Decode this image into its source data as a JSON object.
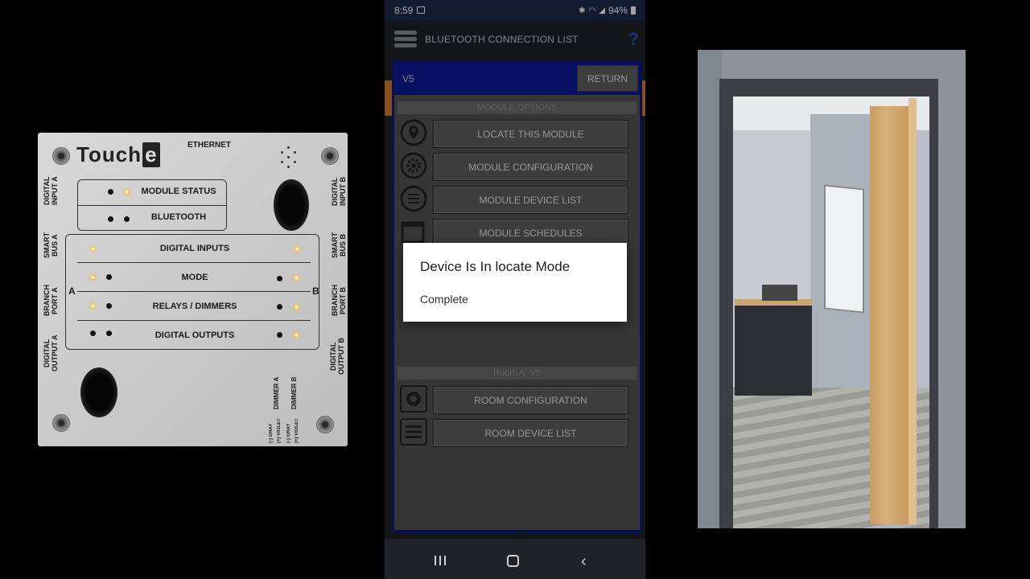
{
  "device": {
    "brand": "Touch",
    "brand_e": "e",
    "ethernet": "ETHERNET",
    "digital_input_a": "DIGITAL INPUT A",
    "digital_input_b": "DIGITAL INPUT B",
    "smart_bus_a": "SMART BUS A",
    "smart_bus_b": "SMART BUS B",
    "branch_port_a": "BRANCH PORT A",
    "branch_port_b": "BRANCH PORT B",
    "digital_output_a": "DIGITAL OUTPUT A",
    "digital_output_b": "DIGITAL OUTPUT B",
    "module_status": "MODULE STATUS",
    "bluetooth": "BLUETOOTH",
    "digital_inputs": "DIGITAL INPUTS",
    "mode": "MODE",
    "relays_dimmers": "RELAYS / DIMMERS",
    "digital_outputs": "DIGITAL OUTPUTS",
    "port_a": "A",
    "port_b": "B",
    "dimmer_a": "DIMMER A",
    "dimmer_b": "DIMMER B",
    "wire_gray": "(-) GRAY",
    "wire_violet": "(+) VIOLET"
  },
  "phone": {
    "status": {
      "time": "8:59",
      "battery": "94%"
    },
    "appbar": {
      "title": "BLUETOOTH CONNECTION LIST",
      "help": "?"
    },
    "card": {
      "name": "V5",
      "return_label": "RETURN",
      "module_options_header": "MODULE OPTIONS",
      "module_buttons": [
        {
          "label": "LOCATE THIS MODULE",
          "icon": "location-pin-icon"
        },
        {
          "label": "MODULE CONFIGURATION",
          "icon": "gear-icon"
        },
        {
          "label": "MODULE DEVICE LIST",
          "icon": "list-icon"
        },
        {
          "label": "MODULE SCHEDULES",
          "icon": "calendar-clock-icon"
        }
      ],
      "room_header": "Room A: V5",
      "room_buttons": [
        {
          "label": "ROOM CONFIGURATION",
          "icon": "gear-icon"
        },
        {
          "label": "ROOM DEVICE LIST",
          "icon": "list-icon"
        }
      ]
    },
    "dialog": {
      "title": "Device Is In locate Mode",
      "message": "Complete"
    },
    "navbar": {
      "back_glyph": "‹"
    }
  }
}
